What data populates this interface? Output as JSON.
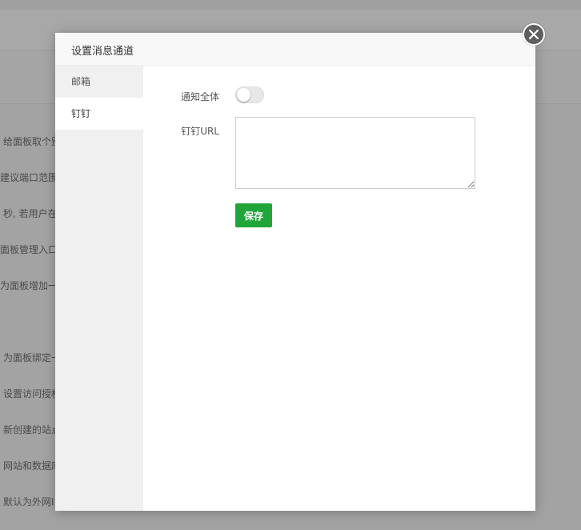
{
  "background": {
    "lines": [
      "给面板取个别",
      "建议端口范围",
      "秒, 若用户在",
      "面板管理入口",
      "为面板增加一",
      "为面板绑定一",
      "设置访问授权",
      "新创建的站点",
      "网站和数据库",
      "默认为外网I"
    ]
  },
  "modal": {
    "title": "设置消息通道",
    "close_icon": "close-icon",
    "nav": [
      {
        "label": "邮箱",
        "active": false
      },
      {
        "label": "钉钉",
        "active": true
      }
    ],
    "form": {
      "notify_all_label": "通知全体",
      "notify_all_enabled": false,
      "url_label": "钉钉URL",
      "url_value": "",
      "save_label": "保存"
    }
  },
  "colors": {
    "accent": "#20a53a",
    "overlay": "#a3a3a3"
  }
}
